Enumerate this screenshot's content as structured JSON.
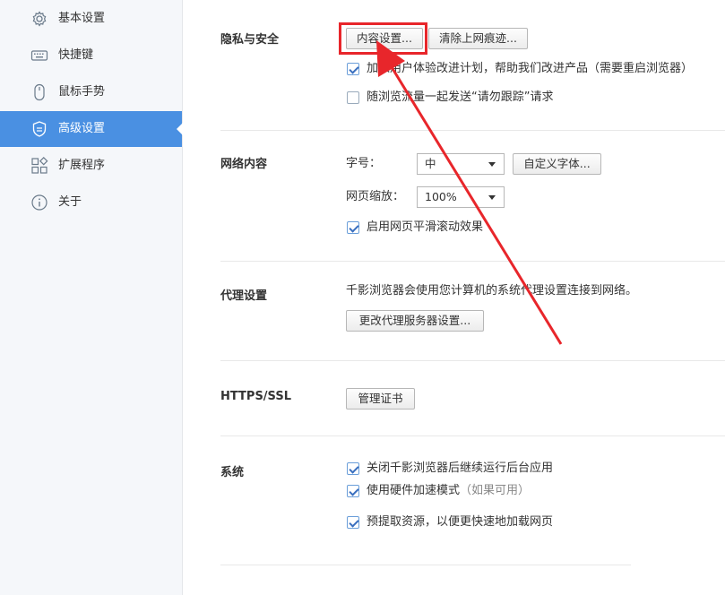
{
  "sidebar": {
    "items": [
      {
        "label": "基本设置",
        "icon": "gear-icon"
      },
      {
        "label": "快捷键",
        "icon": "keyboard-icon"
      },
      {
        "label": "鼠标手势",
        "icon": "mouse-icon"
      },
      {
        "label": "高级设置",
        "icon": "shield-icon",
        "active": true
      },
      {
        "label": "扩展程序",
        "icon": "extensions-icon"
      },
      {
        "label": "关于",
        "icon": "info-icon"
      }
    ]
  },
  "privacy": {
    "title": "隐私与安全",
    "content_settings_button": "内容设置...",
    "clear_history_button": "清除上网痕迹...",
    "join_program_label": "加入用户体验改进计划，帮助我们改进产品（需要重启浏览器）",
    "join_program_checked": true,
    "do_not_track_label": "随浏览流量一起发送“请勿跟踪”请求",
    "do_not_track_checked": false
  },
  "web_content": {
    "title": "网络内容",
    "font_size_label": "字号：",
    "font_size_value": "中",
    "custom_font_button": "自定义字体...",
    "zoom_label": "网页缩放：",
    "zoom_value": "100%",
    "smooth_scroll_label": "启用网页平滑滚动效果",
    "smooth_scroll_checked": true
  },
  "proxy": {
    "title": "代理设置",
    "description": "千影浏览器会使用您计算机的系统代理设置连接到网络。",
    "change_proxy_button": "更改代理服务器设置..."
  },
  "https": {
    "title": "HTTPS/SSL",
    "manage_certs_button": "管理证书"
  },
  "system": {
    "title": "系统",
    "background_apps_label": "关闭千影浏览器后继续运行后台应用",
    "background_apps_checked": true,
    "hw_accel_label": "使用硬件加速模式",
    "hw_accel_note": "（如果可用）",
    "hw_accel_checked": true,
    "prefetch_label": "预提取资源，以便更快速地加载网页",
    "prefetch_checked": true
  },
  "colors": {
    "accent": "#4a90e2",
    "annotation": "#e8262b"
  }
}
